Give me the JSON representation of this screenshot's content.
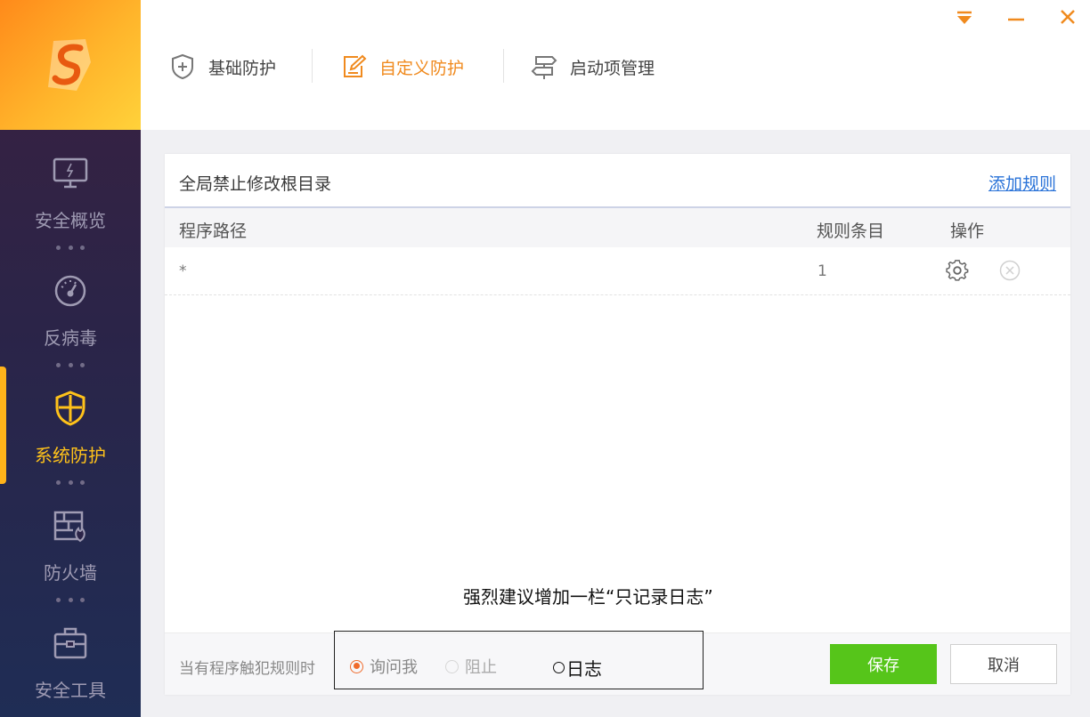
{
  "sidebar": {
    "items": [
      {
        "label": "安全概览",
        "icon": "monitor-icon"
      },
      {
        "label": "反病毒",
        "icon": "gauge-icon"
      },
      {
        "label": "系统防护",
        "icon": "shield-icon",
        "active": true
      },
      {
        "label": "防火墙",
        "icon": "firewall-icon"
      },
      {
        "label": "安全工具",
        "icon": "toolbox-icon"
      }
    ]
  },
  "tabs": [
    {
      "label": "基础防护",
      "icon": "shield-plus-icon"
    },
    {
      "label": "自定义防护",
      "icon": "edit-icon",
      "active": true
    },
    {
      "label": "启动项管理",
      "icon": "signpost-icon"
    }
  ],
  "card": {
    "title": "全局禁止修改根目录",
    "add_rule": "添加规则",
    "columns": {
      "path": "程序路径",
      "count": "规则条目",
      "action": "操作"
    },
    "rows": [
      {
        "path": "*",
        "count": "1"
      }
    ]
  },
  "note": "强烈建议增加一栏“只记录日志”",
  "footer": {
    "label": "当有程序触犯规则时",
    "options": [
      "询问我",
      "阻止",
      "日志"
    ],
    "save": "保存",
    "cancel": "取消"
  },
  "colors": {
    "accent": "#f08a1e",
    "save": "#56c51a",
    "link": "#2a73d8"
  }
}
